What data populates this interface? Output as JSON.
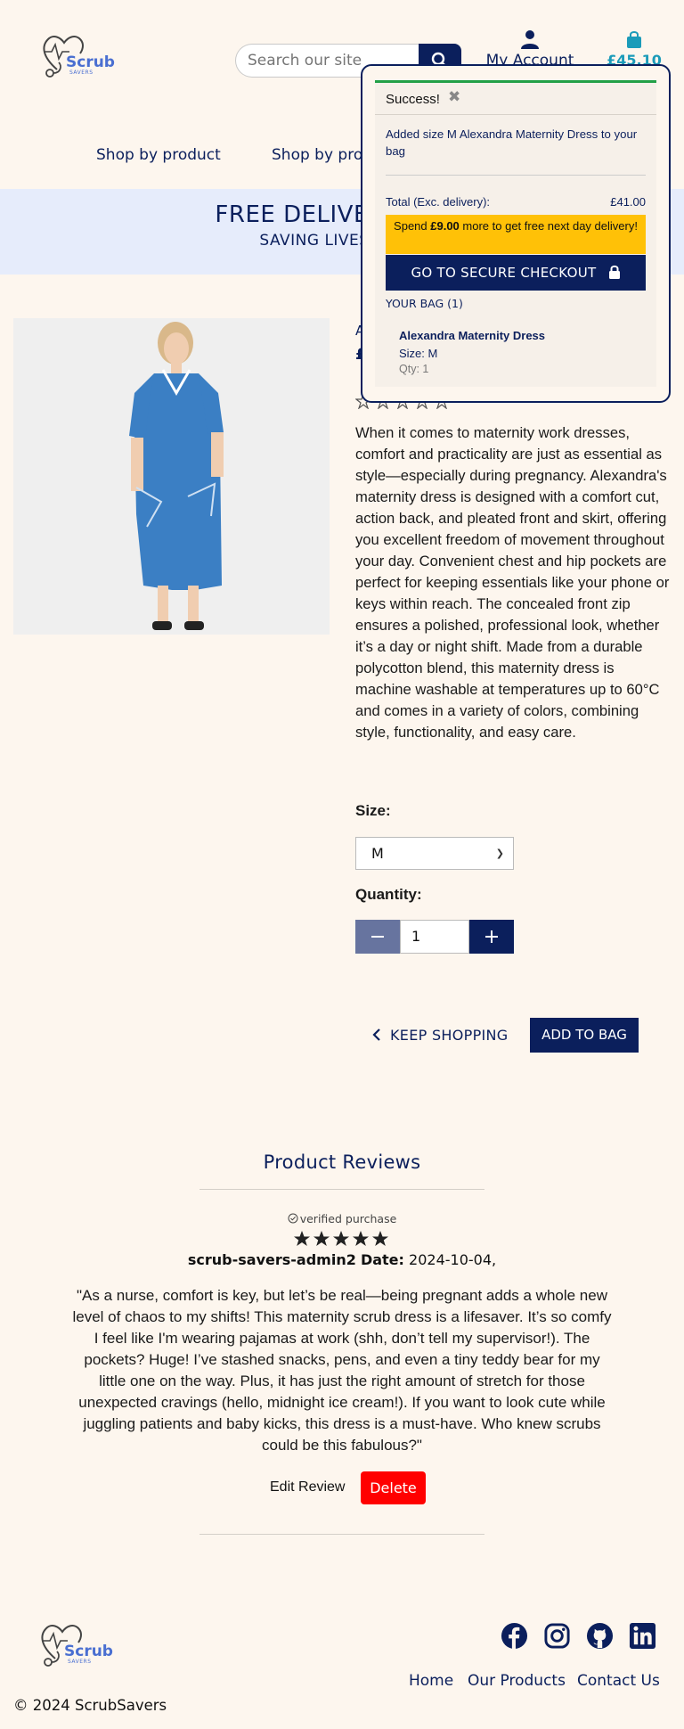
{
  "header": {
    "logo_text": "Scrub",
    "logo_subtext": "SAVERS",
    "search_placeholder": "Search our site",
    "account_label": "My Account",
    "cart_total": "£45.10"
  },
  "nav": {
    "items": [
      "Shop by product",
      "Shop by profe"
    ]
  },
  "banner": {
    "title": "FREE DELIVERY ON O",
    "subtitle": "SAVING LIVES AND S"
  },
  "product": {
    "description": "When it comes to maternity work dresses, comfort and practicality are just as essential as style—especially during pregnancy. Alexandra's maternity dress is designed with a comfort cut, action back, and pleated front and skirt, offering you excellent freedom of movement throughout your day. Convenient chest and hip pockets are perfect for keeping essentials like your phone or keys within reach. The concealed front zip ensures a polished, professional look, whether it’s a day or night shift. Made from a durable polycotton blend, this maternity dress is machine washable at temperatures up to 60°C and comes in a variety of colors, combining style, functionality, and easy care.",
    "size_label": "Size:",
    "size_selected": "M",
    "quantity_label": "Quantity:",
    "quantity_value": "1",
    "keep_shopping": "KEEP SHOPPING",
    "add_to_bag": "ADD TO BAG"
  },
  "reviews": {
    "title": "Product Reviews",
    "items": [
      {
        "verified": "verified purchase",
        "rating": 5,
        "author": "scrub-savers-admin2",
        "date_label": "Date:",
        "date": "2024-10-04,",
        "text": "\"As a nurse, comfort is key, but let’s be real—being pregnant adds a whole new level of chaos to my shifts! This maternity scrub dress is a lifesaver. It’s so comfy I feel like I'm wearing pajamas at work (shh, don’t tell my supervisor!). The pockets? Huge! I’ve stashed snacks, pens, and even a tiny teddy bear for my little one on the way. Plus, it has just the right amount of stretch for those unexpected cravings (hello, midnight ice cream!). If you want to look cute while juggling patients and baby kicks, this dress is a must-have. Who knew scrubs could be this fabulous?\"",
        "edit_label": "Edit Review",
        "delete_label": "Delete"
      }
    ]
  },
  "popup": {
    "status": "Success!",
    "message": "Added size M Alexandra Maternity Dress to your bag",
    "total_label": "Total (Exc. delivery):",
    "total_value": "£41.00",
    "spend_prefix": "Spend ",
    "spend_amount": "£9.00",
    "spend_suffix": " more to get free next day delivery!",
    "checkout_label": "GO TO SECURE CHECKOUT",
    "bag_label": "YOUR BAG (1)",
    "item_name": "Alexandra Maternity Dress",
    "item_size": "Size: M",
    "item_qty": "Qty: 1"
  },
  "footer": {
    "links": [
      "Home",
      "Our Products",
      "Contact Us"
    ],
    "copyright": "© 2024 ScrubSavers",
    "social_icons": [
      "facebook-icon",
      "instagram-icon",
      "github-icon",
      "linkedin-icon"
    ]
  },
  "colors": {
    "navy": "#0b1f5c",
    "accent_teal": "#1b9bb9",
    "background": "#fdf6ee",
    "banner_bg": "#e6ecfb",
    "success_green": "#22a047",
    "spend_yellow": "#ffc107",
    "delete_red": "#ff0000"
  }
}
